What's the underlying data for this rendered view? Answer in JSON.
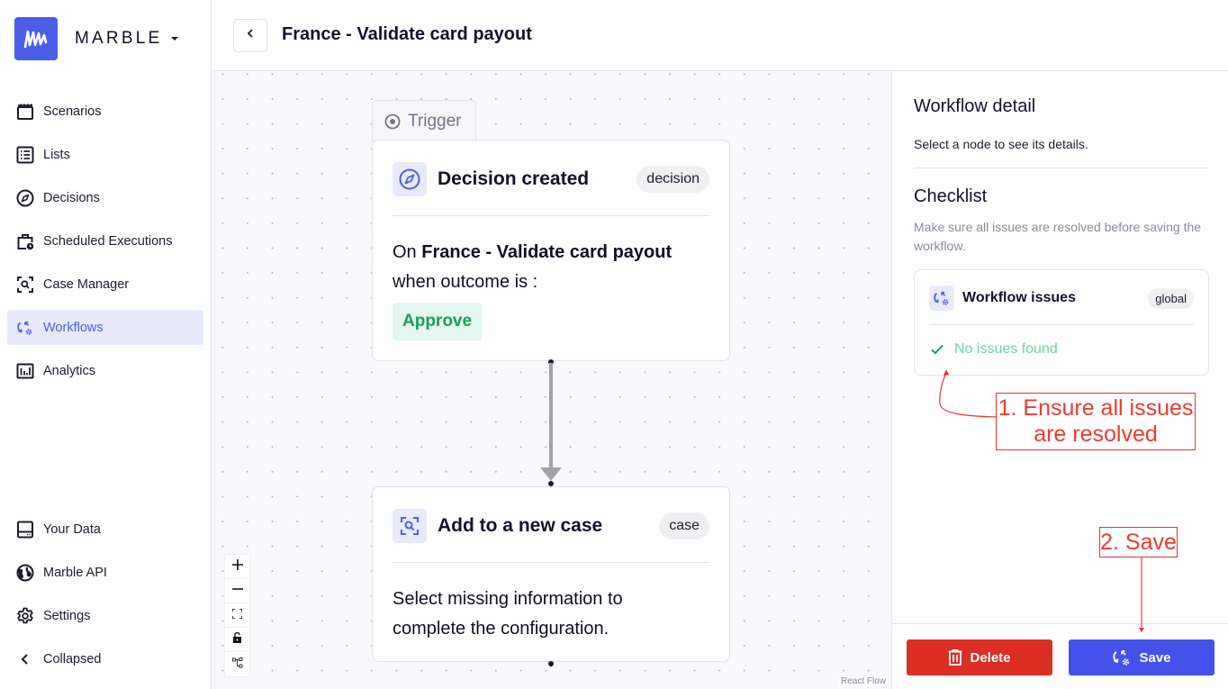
{
  "app": {
    "brand": "MARBLE",
    "logo_icon": "marble-logo-icon",
    "brand_menu_icon": "caret-down-icon",
    "accent_color": "#4a5ee8"
  },
  "sidebar": {
    "items": [
      {
        "label": "Scenarios",
        "icon": "clapperboard-icon",
        "active": false
      },
      {
        "label": "Lists",
        "icon": "list-icon",
        "active": false
      },
      {
        "label": "Decisions",
        "icon": "compass-icon",
        "active": false
      },
      {
        "label": "Scheduled Executions",
        "icon": "briefcase-clock-icon",
        "active": false
      },
      {
        "label": "Case Manager",
        "icon": "scan-search-icon",
        "active": false
      },
      {
        "label": "Workflows",
        "icon": "workflow-icon",
        "active": true
      },
      {
        "label": "Analytics",
        "icon": "chart-icon",
        "active": false
      }
    ],
    "bottom_items": [
      {
        "label": "Your Data",
        "icon": "database-icon"
      },
      {
        "label": "Marble API",
        "icon": "globe-icon"
      },
      {
        "label": "Settings",
        "icon": "gear-icon"
      },
      {
        "label": "Collapsed",
        "icon": "chevron-left-icon"
      }
    ]
  },
  "header": {
    "back_icon": "chevron-left-icon",
    "title": "France - Validate card payout"
  },
  "canvas": {
    "trigger_tab": {
      "label": "Trigger",
      "icon": "radio-target-icon"
    },
    "nodes": [
      {
        "title": "Decision created",
        "badge": "decision",
        "icon": "compass-icon",
        "body_prefix": "On",
        "body_scenario": "France - Validate card payout",
        "body_suffix": "when outcome is :",
        "outcome": "Approve",
        "outcome_color": "#1a9d5f"
      },
      {
        "title": "Add to a new case",
        "badge": "case",
        "icon": "scan-search-icon",
        "body": "Select missing information to complete the configuration."
      }
    ],
    "controls": [
      {
        "name": "zoom-in",
        "icon": "plus-icon"
      },
      {
        "name": "zoom-out",
        "icon": "minus-icon"
      },
      {
        "name": "fit-view",
        "icon": "fullscreen-icon"
      },
      {
        "name": "toggle-interactivity",
        "icon": "lock-icon"
      },
      {
        "name": "auto-layout",
        "icon": "layout-nodes-icon"
      }
    ],
    "attribution": "React Flow"
  },
  "panel": {
    "title": "Workflow detail",
    "subtitle": "Select a node to see its details.",
    "checklist_title": "Checklist",
    "checklist_desc": "Make sure all issues are resolved before saving the workflow.",
    "issues_card": {
      "title": "Workflow issues",
      "badge": "global",
      "status": "No issues found",
      "status_icon": "check-icon",
      "status_color": "#6fd1a4"
    },
    "delete_label": "Delete",
    "save_label": "Save",
    "delete_color": "#dc2e22",
    "save_color": "#4252ea"
  },
  "annotations": {
    "step1": "1. Ensure all issues are resolved",
    "step1_line1": "1. Ensure all issues",
    "step1_line2": "are resolved",
    "step2": "2. Save",
    "color": "#e8322a"
  }
}
